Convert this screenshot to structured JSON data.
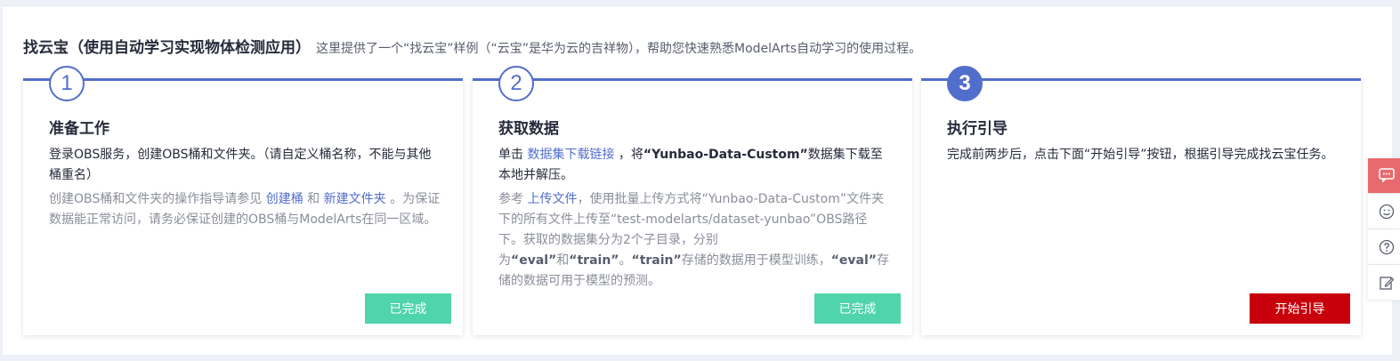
{
  "header": {
    "title": "找云宝（使用自动学习实现物体检测应用）",
    "description": "这里提供了一个“找云宝”样例（“云宝”是华为云的吉祥物），帮助您快速熟悉ModelArts自动学习的使用过程。"
  },
  "steps": [
    {
      "number": "1",
      "title": "准备工作",
      "main": "登录OBS服务，创建OBS桶和文件夹。（请自定义桶名称，不能与其他桶重名）",
      "sub_prefix": "创建OBS桶和文件夹的操作指导请参见",
      "link1": "创建桶",
      "sub_and": "和",
      "link2": "新建文件夹",
      "sub_suffix": "。为保证数据能正常访问，请务必保证创建的OBS桶与ModelArts在同一区域。",
      "button": "已完成"
    },
    {
      "number": "2",
      "title": "获取数据",
      "main_prefix": "单击",
      "main_link": "数据集下载链接",
      "main_mid": "，将",
      "main_bold": "“Yunbao-Data-Custom”",
      "main_suffix": "数据集下载至本地并解压。",
      "sub_prefix": "参考",
      "sub_link": "上传文件",
      "sub_text1": "，使用批量上传方式将“Yunbao-Data-Custom”文件夹下的所有文件上传至“test-modelarts/dataset-yunbao”OBS路径下。获取的数据集分为2个子目录，分别为",
      "sub_eval1": "“eval”",
      "sub_and": "和",
      "sub_train1": "“train”",
      "sub_text2": "。",
      "sub_train2": "“train”",
      "sub_text3": "存储的数据用于模型训练，",
      "sub_eval2": "“eval”",
      "sub_text4": "存储的数据可用于模型的预测。",
      "button": "已完成"
    },
    {
      "number": "3",
      "title": "执行引导",
      "main": "完成前两步后，点击下面“开始引导”按钮，根据引导完成找云宝任务。",
      "button": "开始引导"
    }
  ],
  "side_tools": [
    "chat-icon",
    "smile-icon",
    "help-icon",
    "edit-icon"
  ],
  "colors": {
    "accent": "#526ecc",
    "done": "#50d4ab",
    "start": "#c7000b",
    "chat": "#e96a6e"
  }
}
